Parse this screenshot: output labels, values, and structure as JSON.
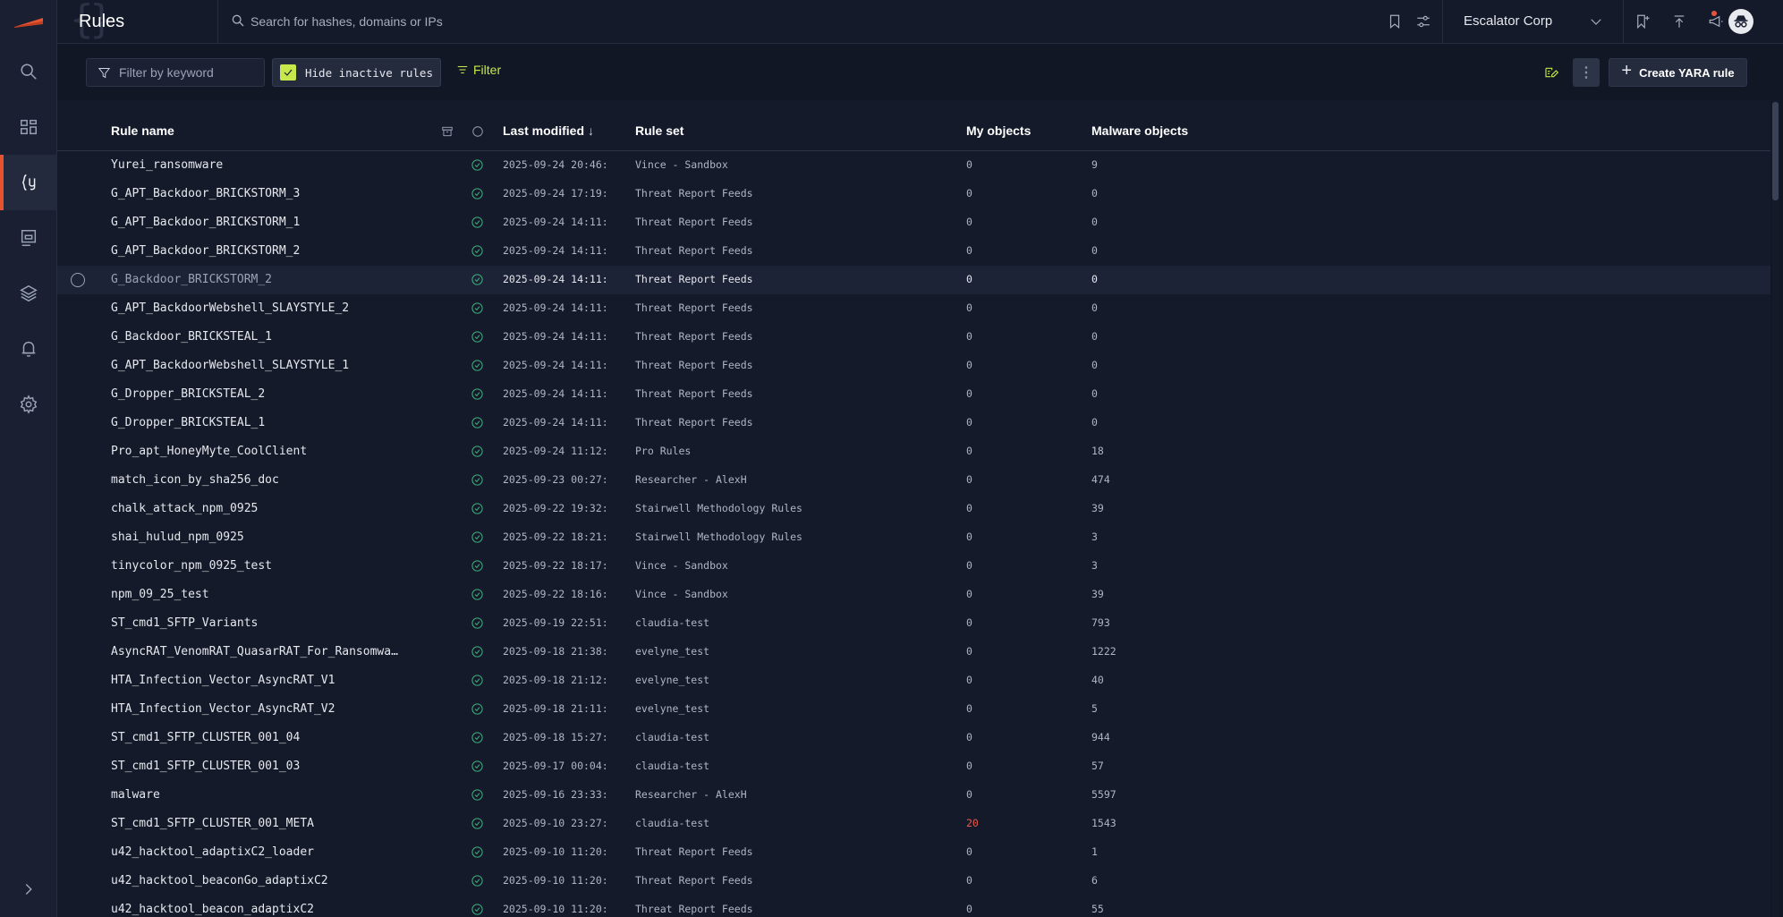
{
  "header": {
    "title": "Rules",
    "search_placeholder": "Search for hashes, domains or IPs",
    "org_name": "Escalator Corp"
  },
  "sidebar": {
    "items": [
      {
        "name": "search",
        "icon": "search-icon"
      },
      {
        "name": "dashboard",
        "icon": "dashboard-icon"
      },
      {
        "name": "rules",
        "icon": "yara-rules-icon",
        "active": true
      },
      {
        "name": "reports",
        "icon": "reports-icon"
      },
      {
        "name": "layers",
        "icon": "layers-icon"
      },
      {
        "name": "notifications",
        "icon": "bell-icon"
      },
      {
        "name": "settings",
        "icon": "gear-icon"
      }
    ],
    "expand_icon": "chevron-right-icon"
  },
  "toolbar": {
    "keyword_placeholder": "Filter by keyword",
    "hide_inactive_label": "Hide inactive rules",
    "hide_inactive_checked": true,
    "filter_label": "Filter",
    "create_label": "Create YARA rule"
  },
  "colors": {
    "accent": "#c6e84a",
    "brand": "#e8532f",
    "active_status": "#3fae7c",
    "highlight_count": "#e85a4a"
  },
  "table": {
    "columns": {
      "rule_name": "Rule name",
      "last_modified": "Last modified",
      "rule_set": "Rule set",
      "my_objects": "My objects",
      "malware_objects": "Malware objects"
    },
    "sort_indicator": "↓",
    "rows": [
      {
        "name": "Yurei_ransomware",
        "date": "2025-09-24 20:46:",
        "ruleset": "Vince - Sandbox",
        "my": "0",
        "mal": "9"
      },
      {
        "name": "G_APT_Backdoor_BRICKSTORM_3",
        "date": "2025-09-24 17:19:",
        "ruleset": "Threat Report Feeds",
        "my": "0",
        "mal": "0"
      },
      {
        "name": "G_APT_Backdoor_BRICKSTORM_1",
        "date": "2025-09-24 14:11:",
        "ruleset": "Threat Report Feeds",
        "my": "0",
        "mal": "0"
      },
      {
        "name": "G_APT_Backdoor_BRICKSTORM_2",
        "date": "2025-09-24 14:11:",
        "ruleset": "Threat Report Feeds",
        "my": "0",
        "mal": "0"
      },
      {
        "name": "G_Backdoor_BRICKSTORM_2",
        "date": "2025-09-24 14:11:",
        "ruleset": "Threat Report Feeds",
        "my": "0",
        "mal": "0",
        "hovered": true
      },
      {
        "name": "G_APT_BackdoorWebshell_SLAYSTYLE_2",
        "date": "2025-09-24 14:11:",
        "ruleset": "Threat Report Feeds",
        "my": "0",
        "mal": "0"
      },
      {
        "name": "G_Backdoor_BRICKSTEAL_1",
        "date": "2025-09-24 14:11:",
        "ruleset": "Threat Report Feeds",
        "my": "0",
        "mal": "0"
      },
      {
        "name": "G_APT_BackdoorWebshell_SLAYSTYLE_1",
        "date": "2025-09-24 14:11:",
        "ruleset": "Threat Report Feeds",
        "my": "0",
        "mal": "0"
      },
      {
        "name": "G_Dropper_BRICKSTEAL_2",
        "date": "2025-09-24 14:11:",
        "ruleset": "Threat Report Feeds",
        "my": "0",
        "mal": "0"
      },
      {
        "name": "G_Dropper_BRICKSTEAL_1",
        "date": "2025-09-24 14:11:",
        "ruleset": "Threat Report Feeds",
        "my": "0",
        "mal": "0"
      },
      {
        "name": "Pro_apt_HoneyMyte_CoolClient",
        "date": "2025-09-24 11:12:",
        "ruleset": "Pro Rules",
        "my": "0",
        "mal": "18"
      },
      {
        "name": "match_icon_by_sha256_doc",
        "date": "2025-09-23 00:27:",
        "ruleset": "Researcher - AlexH",
        "my": "0",
        "mal": "474"
      },
      {
        "name": "chalk_attack_npm_0925",
        "date": "2025-09-22 19:32:",
        "ruleset": "Stairwell Methodology Rules",
        "my": "0",
        "mal": "39"
      },
      {
        "name": "shai_hulud_npm_0925",
        "date": "2025-09-22 18:21:",
        "ruleset": "Stairwell Methodology Rules",
        "my": "0",
        "mal": "3"
      },
      {
        "name": "tinycolor_npm_0925_test",
        "date": "2025-09-22 18:17:",
        "ruleset": "Vince - Sandbox",
        "my": "0",
        "mal": "3"
      },
      {
        "name": "npm_09_25_test",
        "date": "2025-09-22 18:16:",
        "ruleset": "Vince - Sandbox",
        "my": "0",
        "mal": "39"
      },
      {
        "name": "ST_cmd1_SFTP_Variants",
        "date": "2025-09-19 22:51:",
        "ruleset": "claudia-test",
        "my": "0",
        "mal": "793"
      },
      {
        "name": "AsyncRAT_VenomRAT_QuasarRAT_For_Ransomwa…",
        "date": "2025-09-18 21:38:",
        "ruleset": "evelyne_test",
        "my": "0",
        "mal": "1222"
      },
      {
        "name": "HTA_Infection_Vector_AsyncRAT_V1",
        "date": "2025-09-18 21:12:",
        "ruleset": "evelyne_test",
        "my": "0",
        "mal": "40"
      },
      {
        "name": "HTA_Infection_Vector_AsyncRAT_V2",
        "date": "2025-09-18 21:11:",
        "ruleset": "evelyne_test",
        "my": "0",
        "mal": "5"
      },
      {
        "name": "ST_cmd1_SFTP_CLUSTER_001_04",
        "date": "2025-09-18 15:27:",
        "ruleset": "claudia-test",
        "my": "0",
        "mal": "944"
      },
      {
        "name": "ST_cmd1_SFTP_CLUSTER_001_03",
        "date": "2025-09-17 00:04:",
        "ruleset": "claudia-test",
        "my": "0",
        "mal": "57"
      },
      {
        "name": "malware",
        "date": "2025-09-16 23:33:",
        "ruleset": "Researcher - AlexH",
        "my": "0",
        "mal": "5597"
      },
      {
        "name": "ST_cmd1_SFTP_CLUSTER_001_META",
        "date": "2025-09-10 23:27:",
        "ruleset": "claudia-test",
        "my": "20",
        "mal": "1543",
        "my_highlight": true
      },
      {
        "name": "u42_hacktool_adaptixC2_loader",
        "date": "2025-09-10 11:20:",
        "ruleset": "Threat Report Feeds",
        "my": "0",
        "mal": "1"
      },
      {
        "name": "u42_hacktool_beaconGo_adaptixC2",
        "date": "2025-09-10 11:20:",
        "ruleset": "Threat Report Feeds",
        "my": "0",
        "mal": "6"
      },
      {
        "name": "u42_hacktool_beacon_adaptixC2",
        "date": "2025-09-10 11:20:",
        "ruleset": "Threat Report Feeds",
        "my": "0",
        "mal": "55"
      }
    ]
  }
}
